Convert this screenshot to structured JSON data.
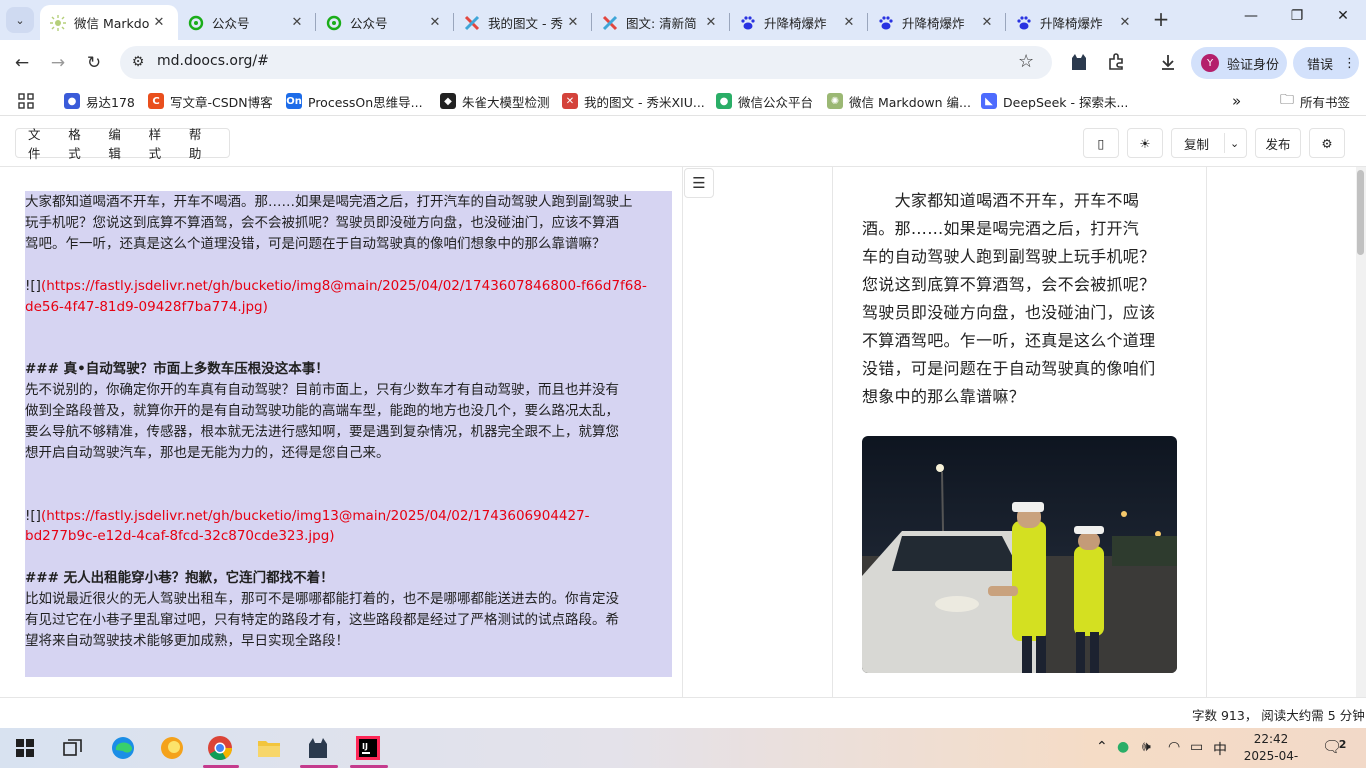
{
  "browser": {
    "tabs": [
      {
        "title": "微信 Markdown",
        "icon": "doocs-icon",
        "active": true
      },
      {
        "title": "公众号",
        "icon": "wechat-mp-icon",
        "active": false
      },
      {
        "title": "公众号",
        "icon": "wechat-mp-icon",
        "active": false
      },
      {
        "title": "我的图文 - 秀",
        "icon": "xiumi-icon",
        "active": false
      },
      {
        "title": "图文: 清新简",
        "icon": "xiumi-icon",
        "active": false
      },
      {
        "title": "升降椅爆炸",
        "icon": "baidu-icon",
        "active": false
      },
      {
        "title": "升降椅爆炸",
        "icon": "baidu-icon",
        "active": false
      },
      {
        "title": "升降椅爆炸",
        "icon": "baidu-icon",
        "active": false
      }
    ],
    "url": "md.doocs.org/#",
    "verify_label": "验证身份",
    "avatar_letter": "Y",
    "error_label": "错误",
    "bookmarks": [
      {
        "label": "易达178",
        "color": "#3a5bd9",
        "glyph": "●"
      },
      {
        "label": "写文章-CSDN博客",
        "color": "#e94f1d",
        "glyph": "C"
      },
      {
        "label": "ProcessOn思维导...",
        "color": "#1d6ce9",
        "glyph": "On"
      },
      {
        "label": "朱雀大模型检测",
        "color": "#222222",
        "glyph": "◆"
      },
      {
        "label": "我的图文 - 秀米XIU...",
        "color": "#d4433b",
        "glyph": "✕"
      },
      {
        "label": "微信公众平台",
        "color": "#2aae67",
        "glyph": "●"
      },
      {
        "label": "微信 Markdown 编...",
        "color": "#9bb874",
        "glyph": "✺"
      },
      {
        "label": "DeepSeek - 探索未...",
        "color": "#4d6bfe",
        "glyph": "◣"
      }
    ],
    "all_bookmarks_label": "所有书签"
  },
  "app": {
    "menus": [
      "文件",
      "格式",
      "编辑",
      "样式",
      "帮助"
    ],
    "copy_label": "复制",
    "publish_label": "发布"
  },
  "editor": {
    "lines": [
      {
        "text": "大家都知道喝酒不开车，开车不喝酒。那……如果是喝完酒之后，打开汽车的自动驾驶人跑到副驾驶上",
        "kind": "text"
      },
      {
        "text": "玩手机呢？您说这到底算不算酒驾，会不会被抓呢？驾驶员即没碰方向盘，也没碰油门，应该不算酒",
        "kind": "text"
      },
      {
        "text": "驾吧。乍一听，还真是这么个道理没错，可是问题在于自动驾驶真的像咱们想象中的那么靠谱嘛？",
        "kind": "text"
      },
      {
        "text": "",
        "kind": "blank"
      },
      {
        "prefix": "![]",
        "link": "(https://fastly.jsdelivr.net/gh/bucketio/img8@main/2025/04/02/1743607846800-f66d7f68-",
        "kind": "link"
      },
      {
        "text": "de56-4f47-81d9-09428f7ba774.jpg)",
        "kind": "linkcont"
      },
      {
        "text": "",
        "kind": "blank"
      },
      {
        "text": "",
        "kind": "blank"
      },
      {
        "text": "### 真•自动驾驶？市面上多数车压根没这本事！",
        "kind": "heading"
      },
      {
        "text": "先不说别的，你确定你开的车真有自动驾驶？目前市面上，只有少数车才有自动驾驶，而且也并没有",
        "kind": "text"
      },
      {
        "text": "做到全路段普及，就算你开的是有自动驾驶功能的高端车型，能跑的地方也没几个，要么路况太乱，",
        "kind": "text"
      },
      {
        "text": "要么导航不够精准，传感器，根本就无法进行感知啊，要是遇到复杂情况，机器完全跟不上，就算您",
        "kind": "text"
      },
      {
        "text": "想开启自动驾驶汽车，那也是无能为力的，还得是您自己来。",
        "kind": "text"
      },
      {
        "text": "",
        "kind": "blank"
      },
      {
        "text": "",
        "kind": "blank"
      },
      {
        "prefix": "![]",
        "link": "(https://fastly.jsdelivr.net/gh/bucketio/img13@main/2025/04/02/1743606904427-",
        "kind": "link"
      },
      {
        "text": "bd277b9c-e12d-4caf-8fcd-32c870cde323.jpg)",
        "kind": "linkcont"
      },
      {
        "text": "",
        "kind": "blank"
      },
      {
        "text": "### 无人出租能穿小巷？抱歉，它连门都找不着！",
        "kind": "heading"
      },
      {
        "text": "比如说最近很火的无人驾驶出租车，那可不是哪哪都能打着的，也不是哪哪都能送进去的。你肯定没",
        "kind": "text"
      },
      {
        "text": "有见过它在小巷子里乱窜过吧，只有特定的路段才有，这些路段都是经过了严格测试的试点路段。希",
        "kind": "text"
      },
      {
        "text": "望将来自动驾驶技术能够更加成熟，早日实现全路段！",
        "kind": "text"
      }
    ]
  },
  "preview": {
    "lines": [
      "　　大家都知道喝酒不开车，开车不喝",
      "酒。那……如果是喝完酒之后，打开汽",
      "车的自动驾驶人跑到副驾驶上玩手机呢？",
      "您说这到底算不算酒驾，会不会被抓呢？",
      "驾驶员即没碰方向盘，也没碰油门，应该",
      "不算酒驾吧。乍一听，还真是这么个道理",
      "没错，可是问题在于自动驾驶真的像咱们",
      "想象中的那么靠谱嘛？"
    ]
  },
  "status": {
    "wordcount": "字数 913， 阅读大约需 5 分钟"
  },
  "taskbar": {
    "time": "22:42",
    "date": "2025-04-03",
    "ime": "中",
    "notifications": "2"
  }
}
